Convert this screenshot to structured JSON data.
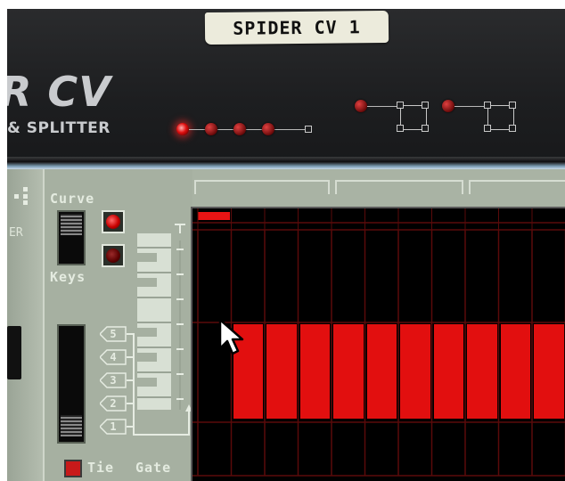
{
  "device_top": {
    "tape_label": "SPIDER CV 1",
    "logo_fragment": "R CV",
    "logo_subtitle": "& SPLITTER"
  },
  "device_bottom": {
    "left_label": "ER",
    "mode_switch": {
      "label_top": "Curve",
      "label_bottom": "Keys"
    },
    "octave_buttons": [
      "5",
      "4",
      "3",
      "2",
      "1"
    ],
    "tie_label": "Tie",
    "gate_label": "Gate",
    "pattern_position_step": 1,
    "step_count": 11,
    "gate_steps_on": [
      2,
      3,
      4,
      5,
      6,
      7,
      8,
      9,
      10,
      11
    ],
    "active_led": "curve",
    "colors": {
      "accent_red": "#e20f0f",
      "panel": "#a9b3a4",
      "grid_bg": "#000000"
    }
  }
}
